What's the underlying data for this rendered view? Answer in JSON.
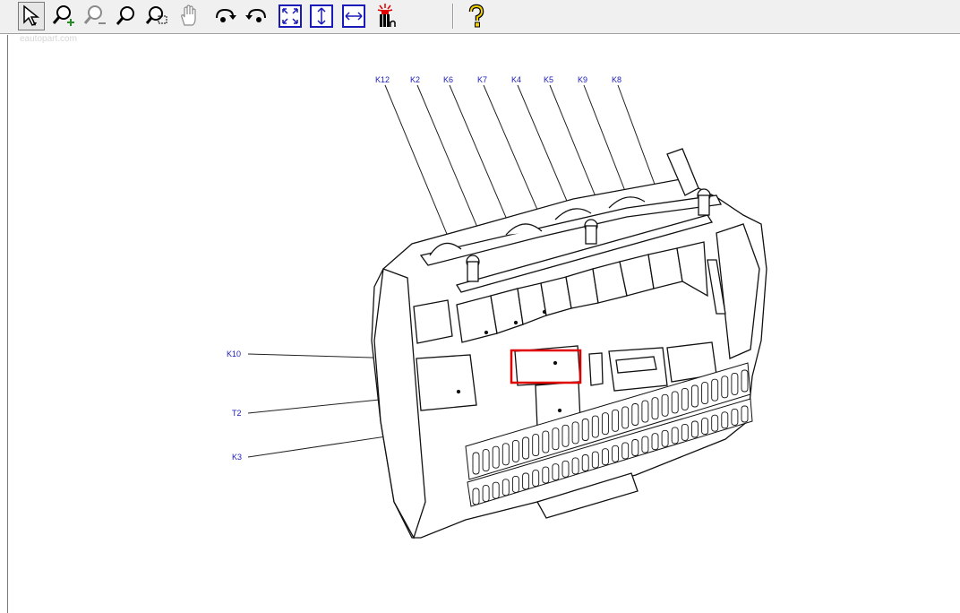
{
  "toolbar": {
    "buttons": [
      {
        "name": "select-arrow-icon",
        "active": true
      },
      {
        "name": "zoom-in-icon",
        "active": false
      },
      {
        "name": "zoom-out-icon",
        "active": false
      },
      {
        "name": "zoom-icon",
        "active": false
      },
      {
        "name": "zoom-window-icon",
        "active": false
      },
      {
        "name": "pan-hand-icon",
        "active": false
      },
      {
        "name": "rotate-right-icon",
        "active": false
      },
      {
        "name": "rotate-left-icon",
        "active": false
      },
      {
        "name": "fit-page-icon",
        "active": false
      },
      {
        "name": "fit-height-icon",
        "active": false
      },
      {
        "name": "fit-width-icon",
        "active": false
      },
      {
        "name": "highlight-icon",
        "active": false
      },
      {
        "name": "help-icon",
        "active": false
      }
    ]
  },
  "watermark": "eautopart.com",
  "diagram": {
    "labels": [
      "K12",
      "K2",
      "K6",
      "K7",
      "K4",
      "K5",
      "K9",
      "K8",
      "K10",
      "T2",
      "K3"
    ],
    "highlight_color": "#e00000",
    "label_color": "#1a1ab8"
  }
}
